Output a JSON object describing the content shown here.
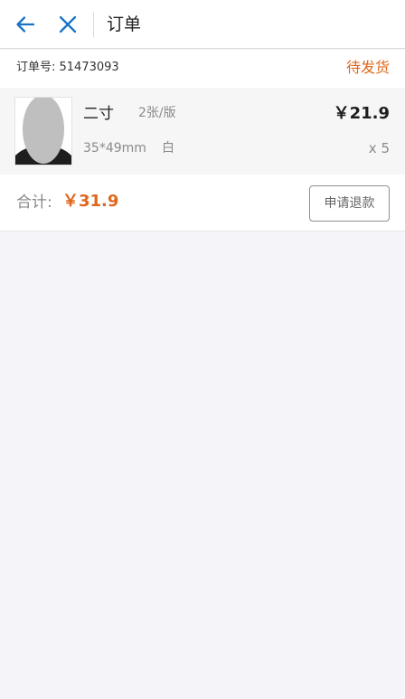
{
  "header": {
    "back_icon": "arrow-left-icon",
    "close_icon": "close-icon",
    "title": "订单",
    "accent_color": "#1a73c7"
  },
  "order": {
    "order_no_label": "订单号: 51473093",
    "status": "待发货",
    "status_color": "#e0661c",
    "item": {
      "photo_icon": "id-photo-thumbnail",
      "name": "二寸",
      "layout": "2张/版",
      "price": "￥21.9",
      "size": "35*49mm",
      "background_color": "白",
      "quantity": "x 5"
    },
    "total_label": "合计:",
    "total_amount": "￥31.9",
    "refund_button": "申请退款"
  }
}
